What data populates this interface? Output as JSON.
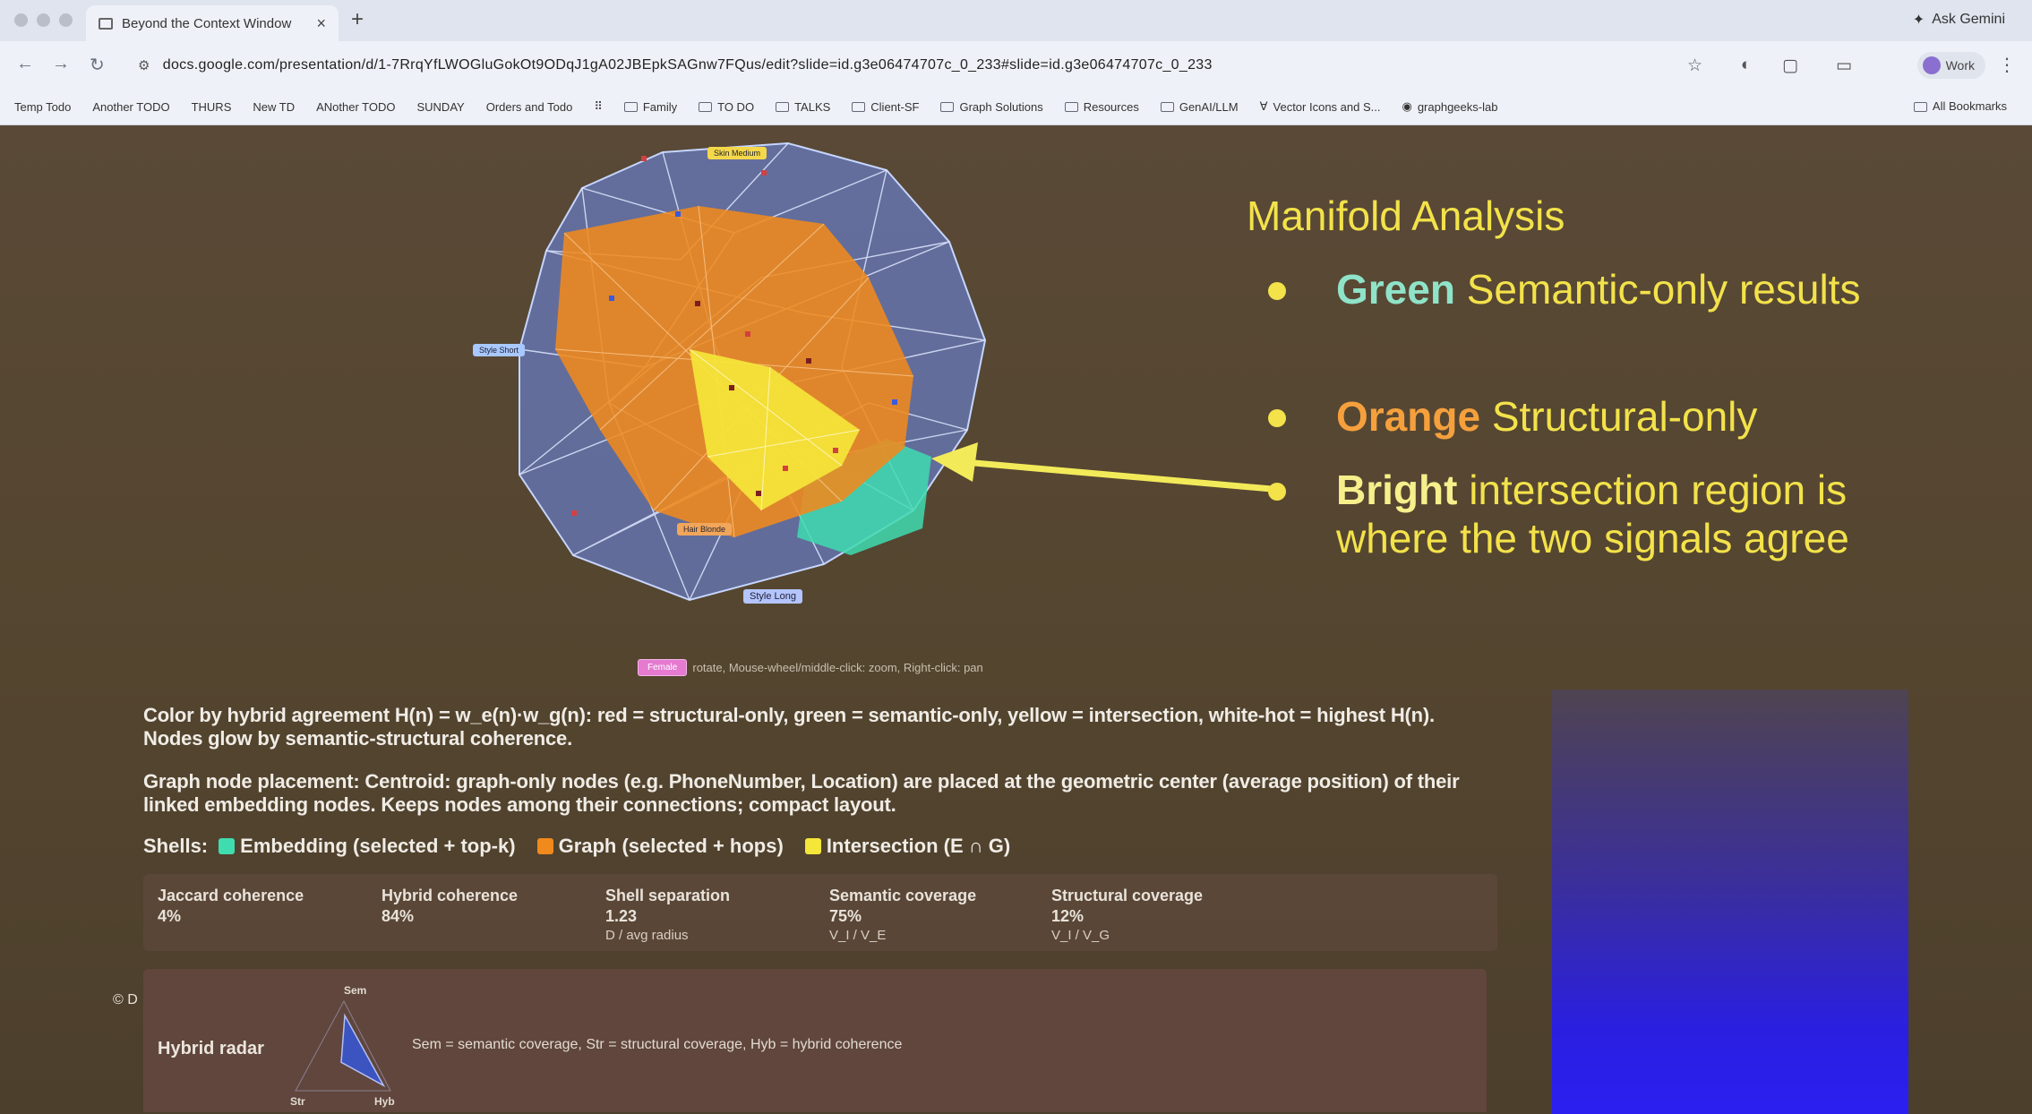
{
  "browser": {
    "tab_title": "Beyond the Context Window",
    "tab_close": "×",
    "new_tab": "+",
    "ask_gemini": "Ask Gemini",
    "url": "docs.google.com/presentation/d/1-7RrqYfLWOGluGokOt9ODqJ1gA02JBEpkSAGnw7FQus/edit?slide=id.g3e06474707c_0_233#slide=id.g3e06474707c_0_233",
    "profile_label": "Work",
    "bookmarks": [
      "Temp Todo",
      "Another TODO",
      "THURS",
      "New TD",
      "ANother TODO",
      "SUNDAY",
      "Orders and Todo"
    ],
    "bookmark_folders": [
      "Family",
      "TO DO",
      "TALKS",
      "Client-SF",
      "Graph Solutions",
      "Resources",
      "GenAI/LLM",
      "Vector Icons and S...",
      "graphgeeks-lab"
    ],
    "all_bookmarks": "All Bookmarks"
  },
  "graph": {
    "node_labels": [
      "Skin Medium",
      "Style Short",
      "Style Long",
      "Hair Blonde"
    ],
    "hint_chip": "Female",
    "hint_text": "rotate, Mouse-wheel/middle-click: zoom, Right-click: pan",
    "colors": {
      "semantic": "#3fdcb0",
      "structural": "#f08a1c",
      "intersection": "#f5e63a",
      "mesh": "#9ab4ff"
    }
  },
  "slide": {
    "title": "Manifold Analysis",
    "bullets": [
      {
        "keyword": "Green",
        "text": " Semantic-only results"
      },
      {
        "keyword": "Orange",
        "text": " Structural-only"
      },
      {
        "keyword": "Bright",
        "text": " intersection region is where the two signals agree"
      }
    ]
  },
  "panel": {
    "color_desc": "Color by hybrid agreement H(n) = w_e(n)·w_g(n): red = structural-only, green = semantic-only, yellow = intersection, white-hot = highest H(n). Nodes glow by semantic-structural coherence.",
    "placement_desc": "Graph node placement: Centroid: graph-only nodes (e.g. PhoneNumber, Location) are placed at the geometric center (average position) of their linked embedding nodes. Keeps nodes among their connections; compact layout.",
    "shells_label": "Shells:",
    "shells": [
      {
        "label": "Embedding (selected + top-k)",
        "color": "#3fdcb0"
      },
      {
        "label": "Graph (selected + hops)",
        "color": "#f08a1c"
      },
      {
        "label": "Intersection (E ∩ G)",
        "color": "#f5e63a"
      }
    ],
    "metrics": [
      {
        "label": "Jaccard coherence",
        "value": "4%",
        "sub": ""
      },
      {
        "label": "Hybrid coherence",
        "value": "84%",
        "sub": ""
      },
      {
        "label": "Shell separation",
        "value": "1.23",
        "sub": "D / avg radius"
      },
      {
        "label": "Semantic coverage",
        "value": "75%",
        "sub": "V_I / V_E"
      },
      {
        "label": "Structural coverage",
        "value": "12%",
        "sub": "V_I / V_G"
      }
    ],
    "cd_mark": "© D",
    "radar": {
      "title": "Hybrid radar",
      "axis_sem": "Sem",
      "axis_str": "Str",
      "axis_hyb": "Hyb",
      "legend": "Sem = semantic coverage, Str = structural coverage, Hyb = hybrid coherence",
      "values": {
        "sem": 0.75,
        "str": 0.12,
        "hyb": 0.84
      }
    }
  }
}
